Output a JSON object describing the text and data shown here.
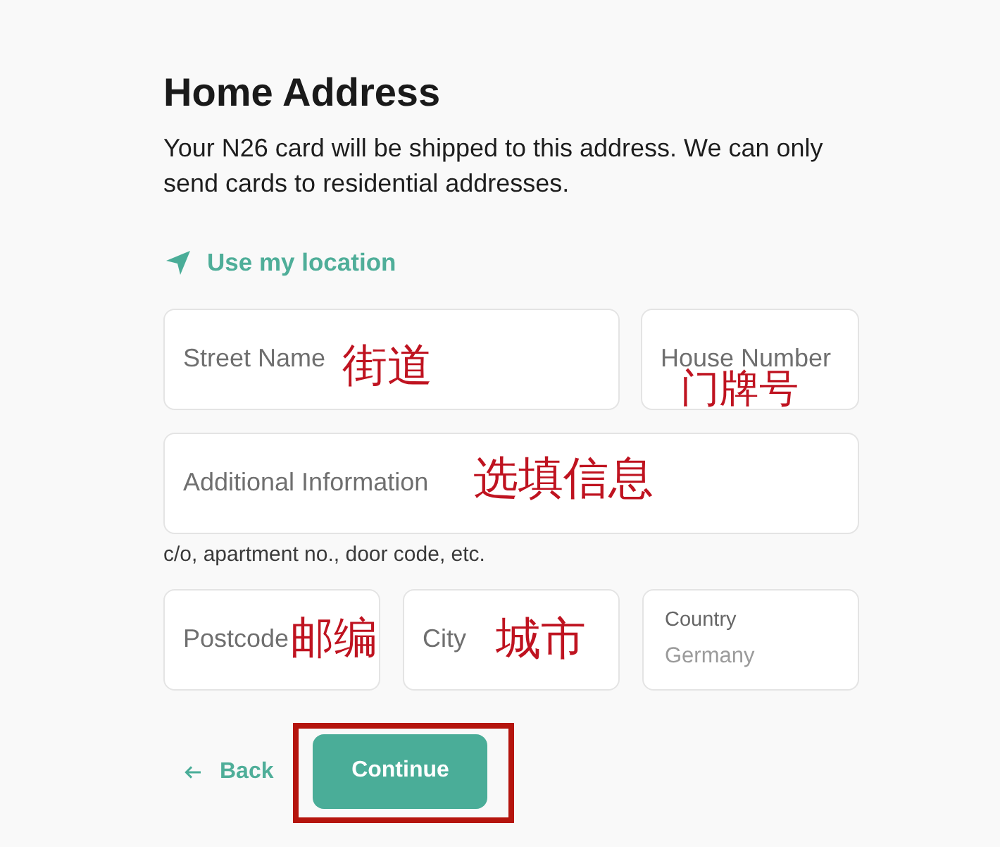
{
  "page": {
    "title": "Home Address",
    "description": "Your N26 card will be shipped to this address. We can only send cards to residential addresses."
  },
  "location_link": {
    "label": "Use my location"
  },
  "form": {
    "rows": [
      {
        "fields": [
          {
            "kind": "text",
            "placeholder": "Street Name",
            "annotation": "街道"
          },
          {
            "kind": "text",
            "placeholder": "House Number",
            "annotation": "门牌号"
          }
        ]
      },
      {
        "fields": [
          {
            "kind": "text",
            "placeholder": "Additional Information",
            "annotation": "选填信息",
            "hint": "c/o, apartment no., door code, etc."
          }
        ]
      },
      {
        "fields": [
          {
            "kind": "text",
            "placeholder": "Postcode",
            "annotation": "邮编"
          },
          {
            "kind": "text",
            "placeholder": "City",
            "annotation": "城市"
          },
          {
            "kind": "select",
            "label": "Country",
            "value": "Germany",
            "disabled": true
          }
        ]
      }
    ]
  },
  "actions": {
    "back": {
      "label": "Back"
    },
    "continue": {
      "label": "Continue",
      "highlighted": true
    }
  }
}
